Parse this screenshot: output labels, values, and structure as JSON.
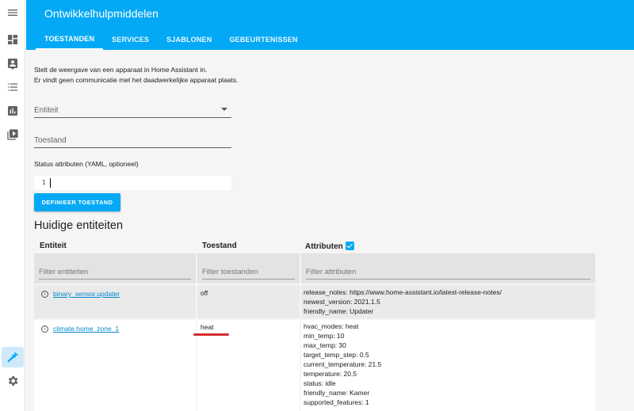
{
  "sidebar": {
    "menu_icon": "menu-icon",
    "items": [
      {
        "icon": "dashboard-icon"
      },
      {
        "icon": "map-icon"
      },
      {
        "icon": "logbook-icon"
      },
      {
        "icon": "history-icon"
      },
      {
        "icon": "media-icon"
      }
    ],
    "developer_tools_icon": "hammer-icon",
    "settings_icon": "gear-icon",
    "accent_color": "#03a9f4"
  },
  "header": {
    "title": "Ontwikkelhulpmiddelen",
    "tabs": [
      {
        "label": "TOESTANDEN",
        "active": true
      },
      {
        "label": "SERVICES",
        "active": false
      },
      {
        "label": "SJABLONEN",
        "active": false
      },
      {
        "label": "GEBEURTENISSEN",
        "active": false
      }
    ]
  },
  "intro": {
    "line1": "Stelt de weergave van een apparaat in Home Assistant in.",
    "line2": "Er vindt geen communicatie met het daadwerkelijke apparaat plaats."
  },
  "form": {
    "entity_label": "Entiteit",
    "state_label": "Toestand",
    "attributes_label": "Status attributen (YAML, optioneel)",
    "editor_line_number": "1",
    "submit_label": "DEFINIEER TOESTAND"
  },
  "current_entities": {
    "title": "Huidige entiteiten",
    "columns": {
      "entity": "Entiteit",
      "state": "Toestand",
      "attributes": "Attributen"
    },
    "show_attributes_checked": true,
    "filters": {
      "entity_placeholder": "Filter entiteiten",
      "state_placeholder": "Filter toestanden",
      "attributes_placeholder": "Filter attributen"
    },
    "rows": [
      {
        "entity": "binary_sensor.updater",
        "state": "off",
        "attributes": [
          "release_notes: https://www.home-assistant.io/latest-release-notes/",
          "newest_version: 2021.1.5",
          "friendly_name: Updater"
        ]
      },
      {
        "entity": "climate.home_zone_1",
        "state": "heat",
        "attributes": [
          "hvac_modes: heat",
          "min_temp: 10",
          "max_temp: 30",
          "target_temp_step: 0.5",
          "current_temperature: 21.5",
          "temperature: 20.5",
          "status: idle",
          "friendly_name: Kamer",
          "supported_features: 1"
        ]
      }
    ]
  },
  "highlight_color": "#d32f2f"
}
